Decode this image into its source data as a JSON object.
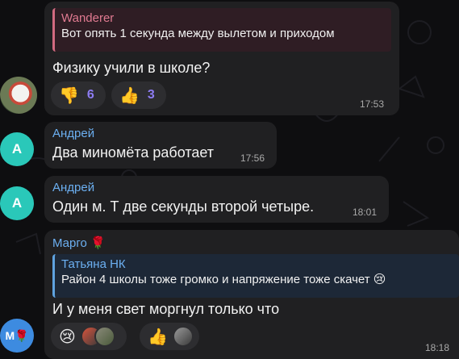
{
  "messages": [
    {
      "reply": {
        "author": "Wanderer",
        "text": "Вот опять 1 секунда между вылетом и приходом"
      },
      "text": "Физику учили в школе?",
      "time": "17:53",
      "reactions": [
        {
          "emoji": "👎",
          "count": "6"
        },
        {
          "emoji": "👍",
          "count": "3"
        }
      ]
    },
    {
      "sender": "Андрей",
      "avatar_letter": "А",
      "text": "Два миномёта работает",
      "time": "17:56"
    },
    {
      "sender": "Андрей",
      "avatar_letter": "А",
      "text": "Один м. Т две секунды второй четыре.",
      "time": "18:01"
    },
    {
      "sender": "Марго 🌹",
      "avatar_letter": "M🌹",
      "reply": {
        "author": "Татьяна НК",
        "text": "Район 4 школы тоже громко и напряжение тоже скачет 😢"
      },
      "text": "И у меня свет моргнул только что",
      "time": "18:18",
      "reactions": [
        {
          "emoji": "😢"
        },
        {
          "emoji": "👍"
        }
      ]
    }
  ],
  "colors": {
    "accent_blue": "#6cb0f2",
    "accent_pink": "#d26a80",
    "reaction_count": "#8d7cf2",
    "avatar_teal": "#2ac8b9"
  }
}
